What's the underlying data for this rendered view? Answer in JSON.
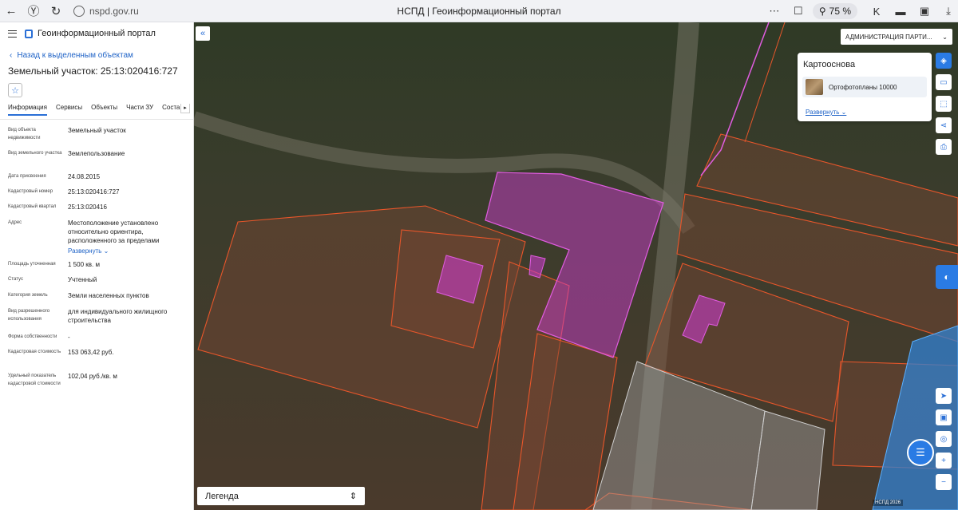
{
  "browser": {
    "url": "nspd.gov.ru",
    "title": "НСПД | Геоинформационный портал",
    "zoom": "75 %"
  },
  "sidebar": {
    "app_title": "Геоинформационный портал",
    "back_link": "Назад к выделенным объектам",
    "object_title": "Земельный участок: 25:13:020416:727",
    "tabs": [
      "Информация",
      "Сервисы",
      "Объекты",
      "Части ЗУ",
      "Соста"
    ],
    "props": [
      {
        "label": "Вид объекта недвижимости",
        "value": "Земельный участок"
      },
      {
        "label": "Вид земельного участка",
        "value": "Землепользование"
      },
      {
        "label": "Дата присвоения",
        "value": "24.08.2015"
      },
      {
        "label": "Кадастровый номер",
        "value": "25:13:020416:727"
      },
      {
        "label": "Кадастровый квартал",
        "value": "25:13:020416"
      },
      {
        "label": "Адрес",
        "value": "Местоположение установлено относительно ориентира, расположенного за пределами",
        "link": "Развернуть"
      },
      {
        "label": "Площадь уточненная",
        "value": "1 500 кв. м"
      },
      {
        "label": "Статус",
        "value": "Учтенный"
      },
      {
        "label": "Категория земель",
        "value": "Земли населенных пунктов"
      },
      {
        "label": "Вид разрешенного использования",
        "value": "для индивидуального жилищного строительства"
      },
      {
        "label": "Форма собственности",
        "value": "-"
      },
      {
        "label": "Кадастровая стоимость",
        "value": "153 063,42 руб."
      },
      {
        "label": "Удельный показатель кадастровой стоимости",
        "value": "102,04 руб./кв. м"
      }
    ]
  },
  "map": {
    "admin_select": "АДМИНИСТРАЦИЯ ПАРТИ...",
    "basemap_title": "Картооснова",
    "basemap_item": "Ортофотопланы 10000",
    "basemap_expand": "Развернуть",
    "legend": "Легенда",
    "attribution": "НСПД 2026"
  },
  "colors": {
    "accent": "#2a7be4",
    "parcel_outline": "#e8562a",
    "selected_parcel": "#c43cc4"
  }
}
